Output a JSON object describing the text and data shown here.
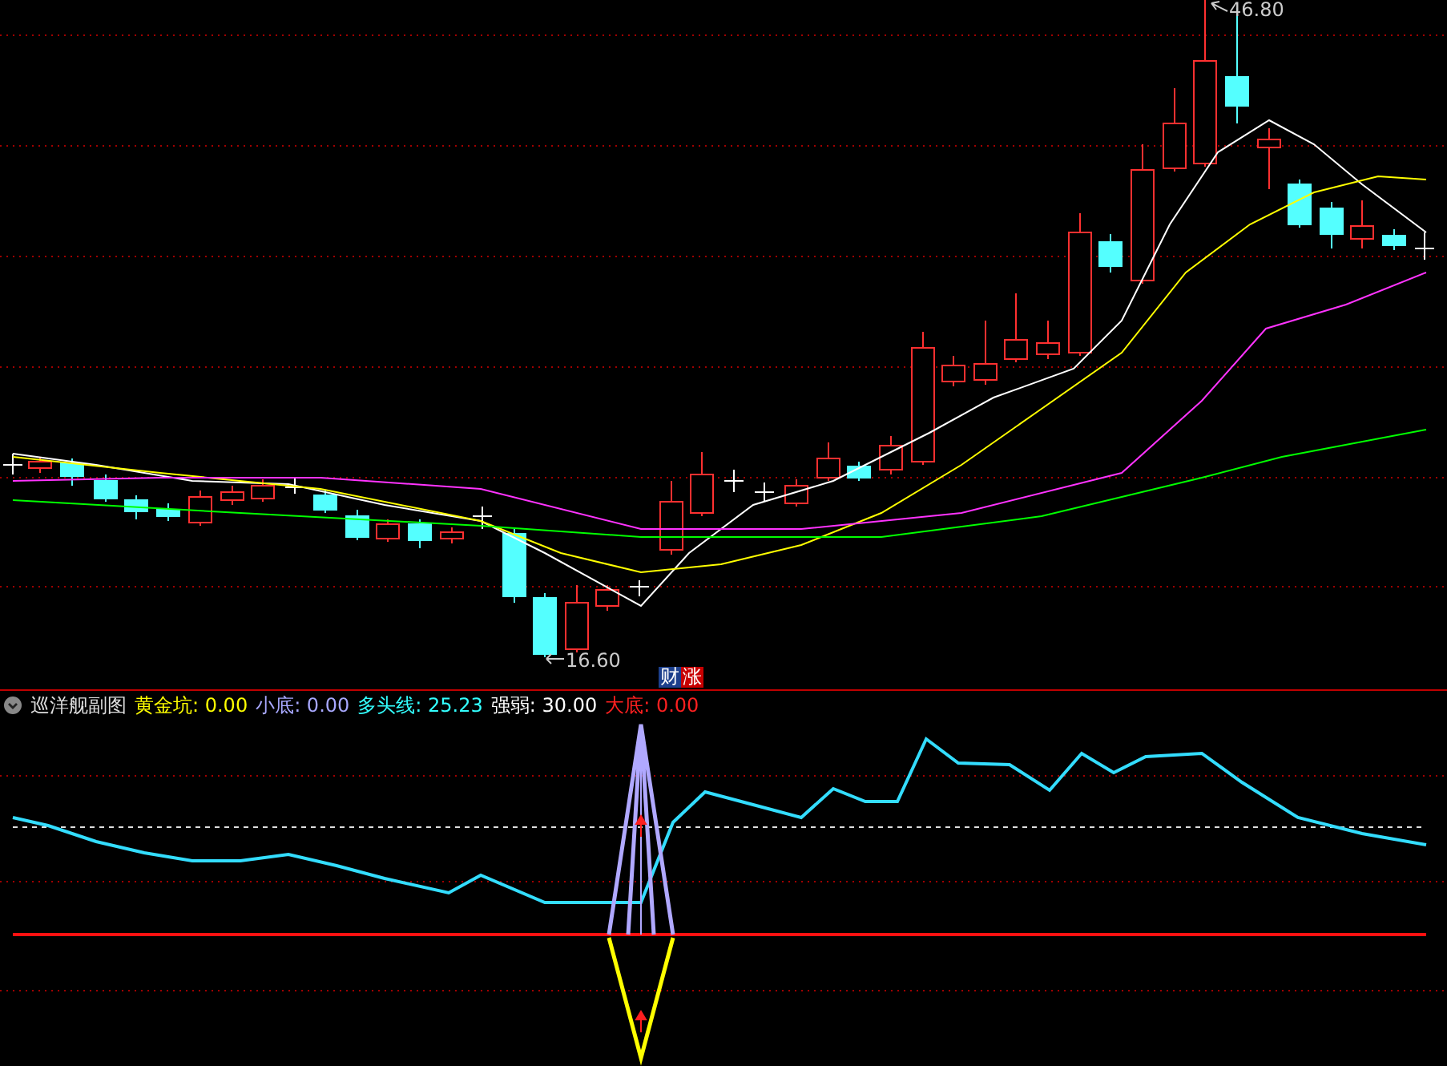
{
  "main_chart": {
    "high_label": "46.80",
    "low_label": "16.60",
    "badges": [
      {
        "text": "财",
        "color": "#1c3f8c"
      },
      {
        "text": "涨",
        "color": "#c80000"
      }
    ]
  },
  "indicator": {
    "title": "巡洋舰副图",
    "readings": [
      {
        "label": "黄金坑:",
        "value": "0.00",
        "color": "#ffff00"
      },
      {
        "label": "小底:",
        "value": "0.00",
        "color": "#a8a8ff"
      },
      {
        "label": "多头线:",
        "value": "25.23",
        "color": "#33ffff"
      },
      {
        "label": "强弱:",
        "value": "30.00",
        "color": "#ffffff"
      },
      {
        "label": "大底:",
        "value": "0.00",
        "color": "#ff2020"
      }
    ]
  }
}
